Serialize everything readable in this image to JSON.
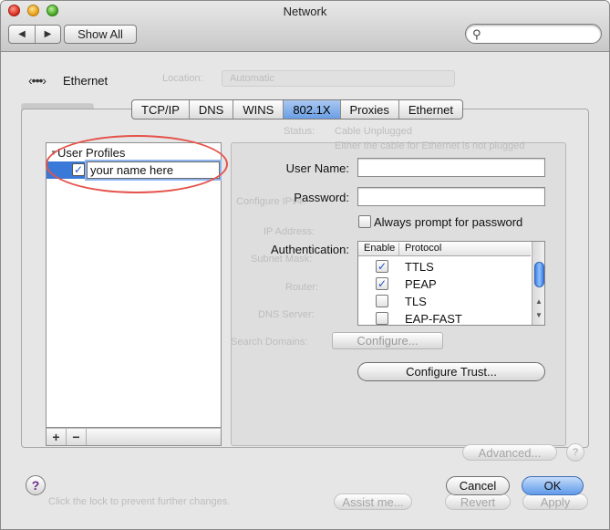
{
  "window": {
    "title": "Network"
  },
  "toolbar": {
    "back_glyph": "◀",
    "forward_glyph": "▶",
    "show_all_label": "Show All",
    "search_placeholder": ""
  },
  "interface": {
    "label": "Ethernet",
    "icon": "ethernet-icon"
  },
  "background_ghost": {
    "location_label": "Location:",
    "location_value": "Automatic",
    "status_label": "Status:",
    "status_value": "Cable Unplugged",
    "status_detail": "Either the cable for Ethernet is not plugged",
    "configure_label": "Configure IPv4:",
    "ip_label": "IP Address:",
    "subnet_label": "Subnet Mask:",
    "router_label": "Router:",
    "dns_label": "DNS Server:",
    "search_domains_label": "Search Domains:",
    "advanced_label": "Advanced...",
    "lock_text": "Click the lock to prevent further changes.",
    "assist_label": "Assist me...",
    "revert_label": "Revert",
    "apply_label": "Apply",
    "help_glyph": "?"
  },
  "tabs": [
    {
      "label": "TCP/IP",
      "active": false
    },
    {
      "label": "DNS",
      "active": false
    },
    {
      "label": "WINS",
      "active": false
    },
    {
      "label": "802.1X",
      "active": true
    },
    {
      "label": "Proxies",
      "active": false
    },
    {
      "label": "Ethernet",
      "active": false
    }
  ],
  "profiles": {
    "header": "User Profiles",
    "items": [
      {
        "name": "your name here",
        "enabled": true
      }
    ],
    "add_label": "+",
    "remove_label": "−"
  },
  "form": {
    "username_label": "User Name:",
    "username_value": "",
    "password_label": "Password:",
    "password_value": "",
    "always_prompt_label": "Always prompt for password",
    "always_prompt_checked": false,
    "auth_label": "Authentication:",
    "auth_columns": {
      "enable": "Enable",
      "protocol": "Protocol"
    },
    "protocols": [
      {
        "name": "TTLS",
        "enabled": true
      },
      {
        "name": "PEAP",
        "enabled": true
      },
      {
        "name": "TLS",
        "enabled": false
      },
      {
        "name": "EAP-FAST",
        "enabled": false
      }
    ],
    "configure_label": "Configure...",
    "configure_trust_label": "Configure Trust..."
  },
  "footer": {
    "help_glyph": "?",
    "cancel_label": "Cancel",
    "ok_label": "OK"
  },
  "colors": {
    "selection": "#3b79d8",
    "annotation_circle": "#e5534b",
    "active_tab": "#6a9ee4"
  }
}
